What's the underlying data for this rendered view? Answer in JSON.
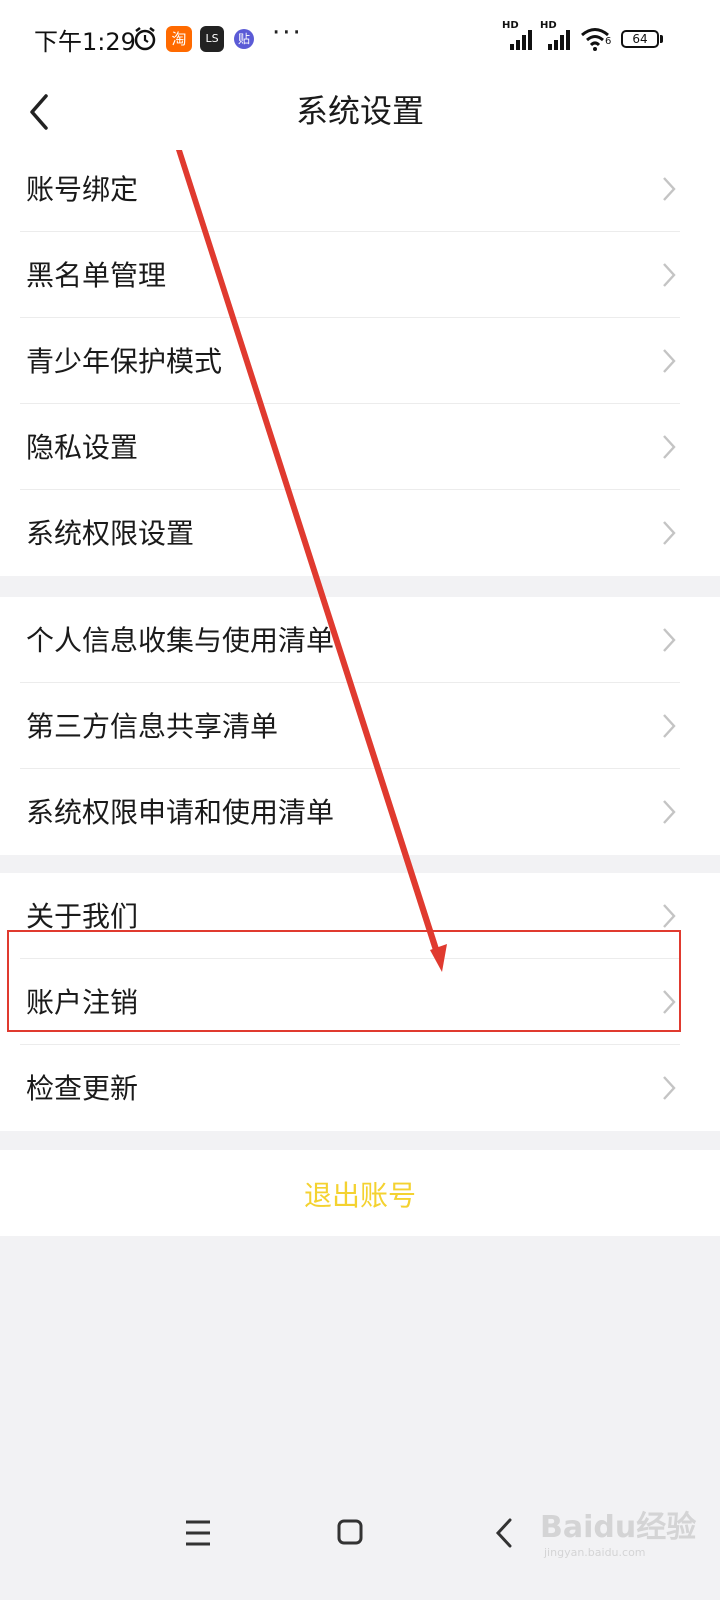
{
  "status_bar": {
    "time": "下午1:29",
    "app_icons": [
      {
        "name": "taobao",
        "text": "淘",
        "color": "#ff6a00"
      },
      {
        "name": "app",
        "text": "LS",
        "color": "#222222"
      },
      {
        "name": "tie",
        "text": "贴",
        "color": "#5b5bd6"
      }
    ],
    "more": "···",
    "network_1": "HD",
    "network_2": "HD",
    "wifi_level": "6",
    "battery": "64"
  },
  "header": {
    "title": "系统设置"
  },
  "groups": [
    {
      "items": [
        {
          "label": "账号绑定"
        },
        {
          "label": "黑名单管理"
        },
        {
          "label": "青少年保护模式"
        },
        {
          "label": "隐私设置"
        },
        {
          "label": "系统权限设置"
        }
      ]
    },
    {
      "items": [
        {
          "label": "个人信息收集与使用清单"
        },
        {
          "label": "第三方信息共享清单"
        },
        {
          "label": "系统权限申请和使用清单"
        }
      ]
    },
    {
      "items": [
        {
          "label": "关于我们"
        },
        {
          "label": "账户注销"
        },
        {
          "label": "检查更新"
        }
      ]
    }
  ],
  "logout": {
    "label": "退出账号"
  },
  "watermark": {
    "brand": "Baidu经验",
    "url": "jingyan.baidu.com"
  },
  "colors": {
    "logout_text": "#f4d230",
    "annotation_red": "#e03a2f",
    "background": "#f2f2f4"
  }
}
